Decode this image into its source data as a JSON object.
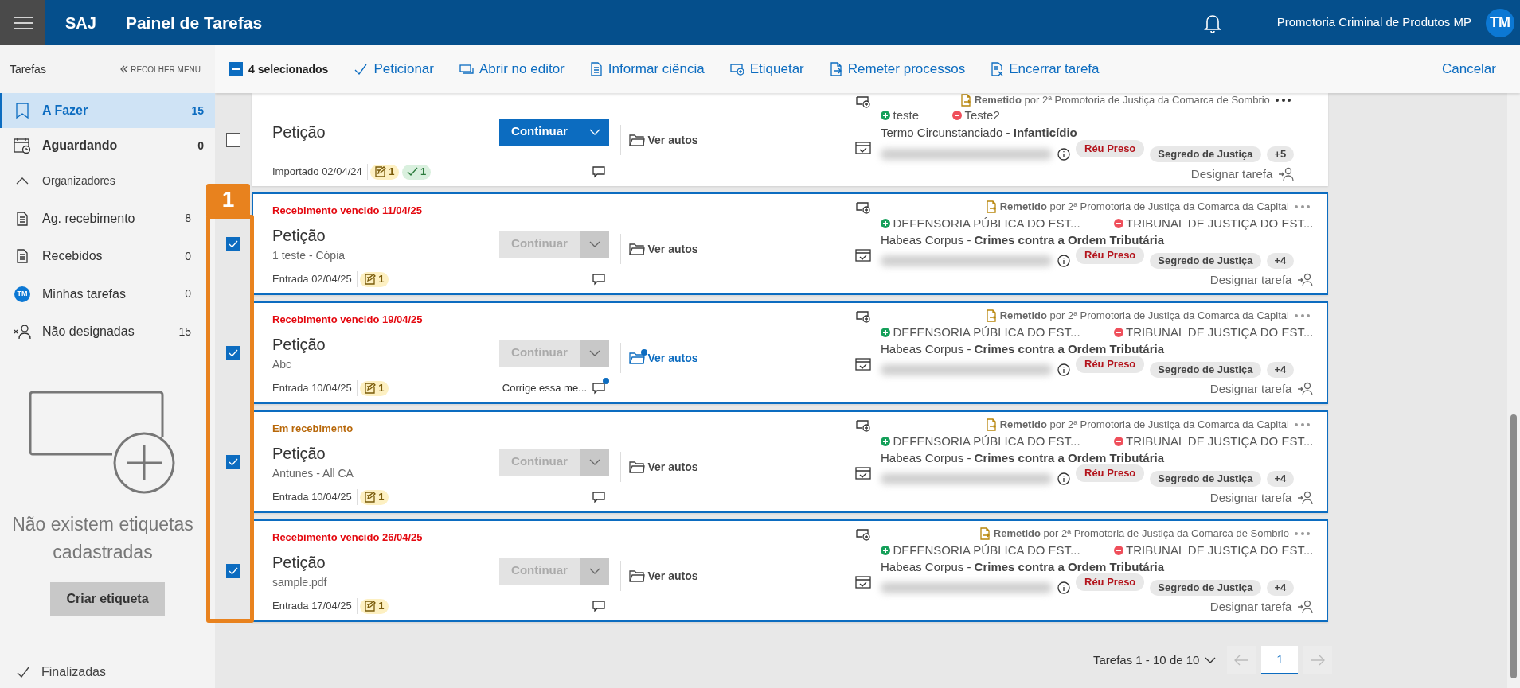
{
  "header": {
    "app": "SAJ",
    "title": "Painel de Tarefas",
    "organization": "Promotoria Criminal de Produtos MP",
    "avatar": "TM"
  },
  "toolbar": {
    "selection": "4 selecionados",
    "indeterminate": true,
    "actions": [
      {
        "label": "Peticionar",
        "kind": "check"
      },
      {
        "label": "Abrir no editor",
        "kind": "editor"
      },
      {
        "label": "Informar ciência",
        "kind": "document"
      },
      {
        "label": "Etiquetar",
        "kind": "label"
      },
      {
        "label": "Remeter processos",
        "kind": "forward"
      },
      {
        "label": "Encerrar tarefa",
        "kind": "close"
      }
    ],
    "cancel": "Cancelar"
  },
  "sidebar": {
    "title": "Tarefas",
    "collapse": "RECOLHER MENU",
    "items": [
      {
        "label": "A Fazer",
        "count": "15",
        "kind": "bookmark",
        "selected": true
      },
      {
        "label": "Aguardando",
        "count": "0",
        "kind": "calendar",
        "selected": false
      }
    ],
    "organizers": {
      "label": "Organizadores",
      "expanded": true,
      "items": [
        {
          "label": "Ag. recebimento",
          "count": "8",
          "kind": "document",
          "selected": false
        },
        {
          "label": "Recebidos",
          "count": "0",
          "kind": "document",
          "selected": false
        },
        {
          "label": "Minhas tarefas",
          "count": "0",
          "kind": "avatar",
          "avatar": "TM",
          "selected": false
        },
        {
          "label": "Não designadas",
          "count": "15",
          "kind": "unassigned",
          "selected": false
        }
      ]
    },
    "empty_state": {
      "message": "Não existem etiquetas cadastradas",
      "button": "Criar etiqueta"
    },
    "footer": "Finalizadas"
  },
  "annotation": {
    "step": "1"
  },
  "tasks": [
    {
      "selected": false,
      "title": "Petição",
      "action": {
        "label": "Continuar",
        "disabled": false
      },
      "date": "Importado 02/04/24",
      "badges": [
        {
          "kind": "draft",
          "count": "1"
        },
        {
          "kind": "done",
          "count": "1"
        }
      ],
      "link": {
        "label": "Ver autos",
        "updated": false
      },
      "forwarded": {
        "status": "Remetido",
        "by": "por 2ª Promotoria de Justiça da Comarca de Sombrio"
      },
      "parties": [
        {
          "name": "teste",
          "kind": "active"
        },
        {
          "name": "Teste2",
          "kind": "passive"
        }
      ],
      "case": "Termo Circunstanciado - **Infanticídio**",
      "tags": [
        {
          "text": "Réu Preso",
          "kind": "alert"
        },
        {
          "text": "Segredo de Justiça",
          "kind": "neutral"
        },
        {
          "text": "+5",
          "kind": "more"
        }
      ],
      "assign": "Designar tarefa"
    },
    {
      "selected": true,
      "alert": {
        "text": "Recebimento vencido 11/04/25",
        "kind": "overdue"
      },
      "title": "Petição",
      "subtitle": "1 teste - Cópia",
      "action": {
        "label": "Continuar",
        "disabled": true
      },
      "date": "Entrada 02/04/25",
      "badges": [
        {
          "kind": "draft",
          "count": "1"
        }
      ],
      "link": {
        "label": "Ver autos",
        "updated": false
      },
      "forwarded": {
        "status": "Remetido",
        "by": "por 2ª Promotoria de Justiça da Comarca da Capital"
      },
      "parties": [
        {
          "name": "DEFENSORIA PÚBLICA DO EST...",
          "kind": "active"
        },
        {
          "name": "TRIBUNAL DE JUSTIÇA DO EST...",
          "kind": "passive"
        }
      ],
      "case": "Habeas Corpus - **Crimes contra a Ordem Tributária**",
      "tags": [
        {
          "text": "Réu Preso",
          "kind": "alert"
        },
        {
          "text": "Segredo de Justiça",
          "kind": "neutral"
        },
        {
          "text": "+4",
          "kind": "more"
        }
      ],
      "assign": "Designar tarefa"
    },
    {
      "selected": true,
      "alert": {
        "text": "Recebimento vencido 19/04/25",
        "kind": "overdue"
      },
      "title": "Petição",
      "subtitle": "Abc",
      "action": {
        "label": "Continuar",
        "disabled": true
      },
      "date": "Entrada 10/04/25",
      "badges": [
        {
          "kind": "draft",
          "count": "1"
        }
      ],
      "comment": {
        "text": "Corrige essa me...",
        "unread": true
      },
      "link": {
        "label": "Ver autos",
        "updated": true
      },
      "forwarded": {
        "status": "Remetido",
        "by": "por 2ª Promotoria de Justiça da Comarca da Capital"
      },
      "parties": [
        {
          "name": "DEFENSORIA PÚBLICA DO EST...",
          "kind": "active"
        },
        {
          "name": "TRIBUNAL DE JUSTIÇA DO EST...",
          "kind": "passive"
        }
      ],
      "case": "Habeas Corpus - **Crimes contra a Ordem Tributária**",
      "tags": [
        {
          "text": "Réu Preso",
          "kind": "alert"
        },
        {
          "text": "Segredo de Justiça",
          "kind": "neutral"
        },
        {
          "text": "+4",
          "kind": "more"
        }
      ],
      "assign": "Designar tarefa"
    },
    {
      "selected": true,
      "alert": {
        "text": "Em recebimento",
        "kind": "receiving"
      },
      "title": "Petição",
      "subtitle": "Antunes - All CA",
      "action": {
        "label": "Continuar",
        "disabled": true
      },
      "date": "Entrada 10/04/25",
      "badges": [
        {
          "kind": "draft",
          "count": "1"
        }
      ],
      "link": {
        "label": "Ver autos",
        "updated": false
      },
      "forwarded": {
        "status": "Remetido",
        "by": "por 2ª Promotoria de Justiça da Comarca da Capital"
      },
      "parties": [
        {
          "name": "DEFENSORIA PÚBLICA DO EST...",
          "kind": "active"
        },
        {
          "name": "TRIBUNAL DE JUSTIÇA DO EST...",
          "kind": "passive"
        }
      ],
      "case": "Habeas Corpus - **Crimes contra a Ordem Tributária**",
      "tags": [
        {
          "text": "Réu Preso",
          "kind": "alert"
        },
        {
          "text": "Segredo de Justiça",
          "kind": "neutral"
        },
        {
          "text": "+4",
          "kind": "more"
        }
      ],
      "assign": "Designar tarefa"
    },
    {
      "selected": true,
      "alert": {
        "text": "Recebimento vencido 26/04/25",
        "kind": "overdue"
      },
      "title": "Petição",
      "subtitle": "sample.pdf",
      "action": {
        "label": "Continuar",
        "disabled": true
      },
      "date": "Entrada 17/04/25",
      "badges": [
        {
          "kind": "draft",
          "count": "1"
        }
      ],
      "link": {
        "label": "Ver autos",
        "updated": false
      },
      "forwarded": {
        "status": "Remetido",
        "by": "por 2ª Promotoria de Justiça da Comarca de Sombrio"
      },
      "parties": [
        {
          "name": "DEFENSORIA PÚBLICA DO EST...",
          "kind": "active"
        },
        {
          "name": "TRIBUNAL DE JUSTIÇA DO EST...",
          "kind": "passive"
        }
      ],
      "case": "Habeas Corpus - **Crimes contra a Ordem Tributária**",
      "tags": [
        {
          "text": "Réu Preso",
          "kind": "alert"
        },
        {
          "text": "Segredo de Justiça",
          "kind": "neutral"
        },
        {
          "text": "+4",
          "kind": "more"
        }
      ],
      "assign": "Designar tarefa"
    }
  ],
  "pagination": {
    "summary": "Tarefas 1 - 10 de 10",
    "prev_disabled": true,
    "next_disabled": true,
    "pages": [
      {
        "label": "1",
        "selected": true
      }
    ]
  }
}
